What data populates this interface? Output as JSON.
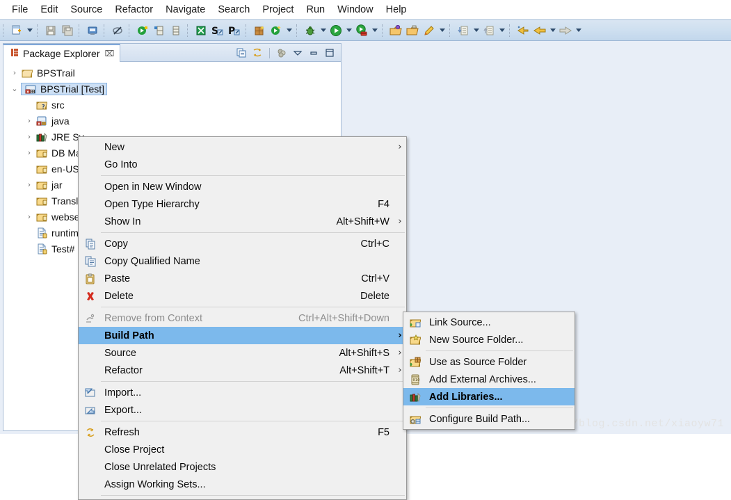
{
  "menubar": {
    "items": [
      {
        "label": "File"
      },
      {
        "label": "Edit"
      },
      {
        "label": "Source"
      },
      {
        "label": "Refactor"
      },
      {
        "label": "Navigate"
      },
      {
        "label": "Search"
      },
      {
        "label": "Project"
      },
      {
        "label": "Run"
      },
      {
        "label": "Window"
      },
      {
        "label": "Help"
      }
    ]
  },
  "toolbar": {
    "buttons": [
      {
        "name": "new-wizard",
        "icon": "new-file-icon"
      },
      {
        "name": "new-wizard-dropdown",
        "icon": "chevron-down-icon"
      },
      {
        "name": "save",
        "icon": "save-icon"
      },
      {
        "name": "save-all",
        "icon": "save-all-icon"
      },
      {
        "name": "print",
        "icon": "print-icon"
      },
      {
        "name": "toggle-mark-occurrences",
        "icon": "mark-occurrences-icon"
      },
      {
        "name": "new-java-project",
        "icon": "java-project-icon"
      },
      {
        "name": "new-package",
        "icon": "package-icon"
      },
      {
        "name": "new-class",
        "icon": "class-icon"
      },
      {
        "name": "external-tools",
        "icon": "external-tools-icon"
      },
      {
        "name": "search-s",
        "icon": "search-s-icon"
      },
      {
        "name": "search-p",
        "icon": "search-p-icon"
      },
      {
        "name": "new-plugin",
        "icon": "plugin-icon"
      },
      {
        "name": "refresh-workspace",
        "icon": "refresh-green-icon"
      },
      {
        "name": "refresh-dropdown",
        "icon": "chevron-down-icon"
      },
      {
        "name": "debug",
        "icon": "debug-bug-icon"
      },
      {
        "name": "debug-dropdown",
        "icon": "chevron-down-icon"
      },
      {
        "name": "run",
        "icon": "run-play-icon"
      },
      {
        "name": "run-dropdown",
        "icon": "chevron-down-icon"
      },
      {
        "name": "run-as-server",
        "icon": "run-server-icon"
      },
      {
        "name": "run-as-server-dropdown",
        "icon": "chevron-down-icon"
      },
      {
        "name": "open-type",
        "icon": "open-type-icon"
      },
      {
        "name": "open-task",
        "icon": "open-folder-icon"
      },
      {
        "name": "new-annotation",
        "icon": "pencil-icon"
      },
      {
        "name": "new-annotation-dropdown",
        "icon": "chevron-down-icon"
      },
      {
        "name": "previous-annotation",
        "icon": "prev-annotation-icon"
      },
      {
        "name": "previous-annotation-dropdown",
        "icon": "chevron-down-icon"
      },
      {
        "name": "next-annotation",
        "icon": "next-annotation-icon"
      },
      {
        "name": "next-annotation-dropdown",
        "icon": "chevron-down-icon"
      },
      {
        "name": "last-edit-location",
        "icon": "last-edit-icon"
      },
      {
        "name": "back",
        "icon": "back-arrow-icon"
      },
      {
        "name": "back-dropdown",
        "icon": "chevron-down-icon"
      },
      {
        "name": "forward",
        "icon": "forward-arrow-icon"
      },
      {
        "name": "forward-dropdown",
        "icon": "chevron-down-icon"
      }
    ]
  },
  "package_explorer": {
    "tab_label": "Package Explorer",
    "tab_close": "⌧",
    "view_tools": [
      {
        "name": "collapse-all-icon",
        "title": "Collapse All"
      },
      {
        "name": "link-with-editor-icon",
        "title": "Link with Editor"
      },
      {
        "name": "view-menu-icon",
        "title": "View Menu"
      },
      {
        "name": "minimize-icon",
        "title": "Minimize"
      },
      {
        "name": "maximize-icon",
        "title": "Maximize"
      }
    ],
    "tree": [
      {
        "label": "BPSTrail",
        "icon": "folder-project-icon",
        "twisty": "›",
        "indent": 1,
        "selected": false
      },
      {
        "label": "BPSTrial [Test]",
        "icon": "java-project-error-icon",
        "twisty": "⌄",
        "indent": 1,
        "selected": true
      },
      {
        "label": "src",
        "icon": "source-folder-icon",
        "twisty": "",
        "indent": 2,
        "selected": false
      },
      {
        "label": "java",
        "icon": "package-error-icon",
        "twisty": "›",
        "indent": 2,
        "selected": false
      },
      {
        "label": "JRE Sy",
        "icon": "jre-library-icon",
        "twisty": "›",
        "indent": 2,
        "selected": false
      },
      {
        "label": "DB Ma",
        "icon": "folder-icon",
        "twisty": "›",
        "indent": 2,
        "selected": false
      },
      {
        "label": "en-US",
        "icon": "folder-icon",
        "twisty": "",
        "indent": 2,
        "selected": false
      },
      {
        "label": "jar",
        "icon": "folder-icon",
        "twisty": "›",
        "indent": 2,
        "selected": false
      },
      {
        "label": "Transl",
        "icon": "folder-icon",
        "twisty": "",
        "indent": 2,
        "selected": false
      },
      {
        "label": "webse",
        "icon": "folder-icon",
        "twisty": "›",
        "indent": 2,
        "selected": false
      },
      {
        "label": "runtim",
        "icon": "file-icon",
        "twisty": "",
        "indent": 2,
        "selected": false
      },
      {
        "label": "Test#",
        "icon": "file-icon",
        "twisty": "",
        "indent": 2,
        "selected": false
      }
    ]
  },
  "context_menu": {
    "items": [
      {
        "type": "item",
        "label": "New",
        "accel": "",
        "submenu": true,
        "icon": "",
        "disabled": false,
        "highlight": false,
        "name": "menu-item-new"
      },
      {
        "type": "item",
        "label": "Go Into",
        "accel": "",
        "submenu": false,
        "icon": "",
        "disabled": false,
        "highlight": false,
        "name": "menu-item-go-into"
      },
      {
        "type": "separator"
      },
      {
        "type": "item",
        "label": "Open in New Window",
        "accel": "",
        "submenu": false,
        "icon": "",
        "disabled": false,
        "highlight": false,
        "name": "menu-item-open-in-new-window"
      },
      {
        "type": "item",
        "label": "Open Type Hierarchy",
        "accel": "F4",
        "submenu": false,
        "icon": "",
        "disabled": false,
        "highlight": false,
        "name": "menu-item-open-type-hierarchy"
      },
      {
        "type": "item",
        "label": "Show In",
        "accel": "Alt+Shift+W",
        "submenu": true,
        "icon": "",
        "disabled": false,
        "highlight": false,
        "name": "menu-item-show-in"
      },
      {
        "type": "separator"
      },
      {
        "type": "item",
        "label": "Copy",
        "accel": "Ctrl+C",
        "submenu": false,
        "icon": "copy-icon",
        "disabled": false,
        "highlight": false,
        "name": "menu-item-copy"
      },
      {
        "type": "item",
        "label": "Copy Qualified Name",
        "accel": "",
        "submenu": false,
        "icon": "copy-qualified-icon",
        "disabled": false,
        "highlight": false,
        "name": "menu-item-copy-qualified-name"
      },
      {
        "type": "item",
        "label": "Paste",
        "accel": "Ctrl+V",
        "submenu": false,
        "icon": "paste-icon",
        "disabled": false,
        "highlight": false,
        "name": "menu-item-paste"
      },
      {
        "type": "item",
        "label": "Delete",
        "accel": "Delete",
        "submenu": false,
        "icon": "delete-x-icon",
        "disabled": false,
        "highlight": false,
        "name": "menu-item-delete"
      },
      {
        "type": "separator"
      },
      {
        "type": "item",
        "label": "Remove from Context",
        "accel": "Ctrl+Alt+Shift+Down",
        "submenu": false,
        "icon": "remove-context-icon",
        "disabled": true,
        "highlight": false,
        "name": "menu-item-remove-from-context"
      },
      {
        "type": "item",
        "label": "Build Path",
        "accel": "",
        "submenu": true,
        "icon": "",
        "disabled": false,
        "highlight": true,
        "name": "menu-item-build-path"
      },
      {
        "type": "item",
        "label": "Source",
        "accel": "Alt+Shift+S",
        "submenu": true,
        "icon": "",
        "disabled": false,
        "highlight": false,
        "name": "menu-item-source"
      },
      {
        "type": "item",
        "label": "Refactor",
        "accel": "Alt+Shift+T",
        "submenu": true,
        "icon": "",
        "disabled": false,
        "highlight": false,
        "name": "menu-item-refactor"
      },
      {
        "type": "separator"
      },
      {
        "type": "item",
        "label": "Import...",
        "accel": "",
        "submenu": false,
        "icon": "import-icon",
        "disabled": false,
        "highlight": false,
        "name": "menu-item-import"
      },
      {
        "type": "item",
        "label": "Export...",
        "accel": "",
        "submenu": false,
        "icon": "export-icon",
        "disabled": false,
        "highlight": false,
        "name": "menu-item-export"
      },
      {
        "type": "separator"
      },
      {
        "type": "item",
        "label": "Refresh",
        "accel": "F5",
        "submenu": false,
        "icon": "refresh-icon",
        "disabled": false,
        "highlight": false,
        "name": "menu-item-refresh"
      },
      {
        "type": "item",
        "label": "Close Project",
        "accel": "",
        "submenu": false,
        "icon": "",
        "disabled": false,
        "highlight": false,
        "name": "menu-item-close-project"
      },
      {
        "type": "item",
        "label": "Close Unrelated Projects",
        "accel": "",
        "submenu": false,
        "icon": "",
        "disabled": false,
        "highlight": false,
        "name": "menu-item-close-unrelated-projects"
      },
      {
        "type": "item",
        "label": "Assign Working Sets...",
        "accel": "",
        "submenu": false,
        "icon": "",
        "disabled": false,
        "highlight": false,
        "name": "menu-item-assign-working-sets"
      },
      {
        "type": "separator"
      }
    ]
  },
  "build_path_submenu": {
    "items": [
      {
        "type": "item",
        "label": "Link Source...",
        "icon": "link-source-icon",
        "highlight": false,
        "name": "submenu-item-link-source"
      },
      {
        "type": "item",
        "label": "New Source Folder...",
        "icon": "new-source-folder-icon",
        "highlight": false,
        "name": "submenu-item-new-source-folder"
      },
      {
        "type": "separator"
      },
      {
        "type": "item",
        "label": "Use as Source Folder",
        "icon": "use-as-source-folder-icon",
        "highlight": false,
        "name": "submenu-item-use-as-source-folder"
      },
      {
        "type": "item",
        "label": "Add External Archives...",
        "icon": "add-external-archives-icon",
        "highlight": false,
        "name": "submenu-item-add-external-archives"
      },
      {
        "type": "item",
        "label": "Add Libraries...",
        "icon": "add-libraries-icon",
        "highlight": true,
        "name": "submenu-item-add-libraries"
      },
      {
        "type": "separator"
      },
      {
        "type": "item",
        "label": "Configure Build Path...",
        "icon": "configure-build-path-icon",
        "highlight": false,
        "name": "submenu-item-configure-build-path"
      }
    ]
  },
  "watermark": {
    "text": "http://blog.csdn.net/xiaoyw71"
  },
  "colors": {
    "toolbar_gradient_top": "#d9e5f2",
    "toolbar_gradient_bottom": "#c2d7ec",
    "menu_background": "#f0f0f0",
    "menu_highlight": "#7cb9ec",
    "tree_selection": "#cde0f5",
    "workbench_background": "#e8eef7"
  }
}
